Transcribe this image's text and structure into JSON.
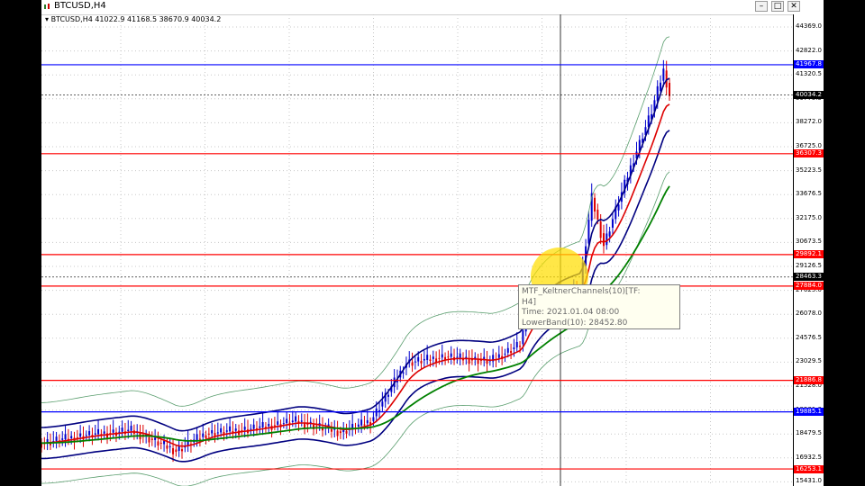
{
  "window": {
    "title": "BTCUSD,H4",
    "min": "–",
    "restore": "□",
    "close": "✕"
  },
  "chart": {
    "symbol_info": "BTCUSD,H4  41022.9 41168.5 38670.9 40034.2",
    "axis_ticks": [
      "44369.0",
      "42822.0",
      "41320.5",
      "39775.5",
      "38272.0",
      "36725.0",
      "35223.5",
      "33676.5",
      "32175.0",
      "30673.5",
      "29126.5",
      "27625.0",
      "26078.0",
      "24576.5",
      "23029.5",
      "21528.0",
      "19981.0",
      "18479.5",
      "16932.5",
      "15431.0"
    ],
    "levels": [
      {
        "label": "41967.8",
        "color": "#0000ff"
      },
      {
        "label": "40034.2",
        "color": "#000000"
      },
      {
        "label": "36307.3",
        "color": "#ff0000"
      },
      {
        "label": "29892.1",
        "color": "#ff0000"
      },
      {
        "label": "28463.3",
        "color": "#000000"
      },
      {
        "label": "27884.0",
        "color": "#ff0000"
      },
      {
        "label": "21886.8",
        "color": "#ff0000"
      },
      {
        "label": "19885.1",
        "color": "#0000ff"
      },
      {
        "label": "16253.1",
        "color": "#ff0000"
      }
    ]
  },
  "tooltip": {
    "line1": "MTF_KeltnerChannels(10)[TF:",
    "line2": "H4]",
    "line3": "Time: 2021.01.04 08:00",
    "line4": "LowerBand(10): 28452.80"
  },
  "icons": {
    "window": "candlestick-chart-icon"
  }
}
